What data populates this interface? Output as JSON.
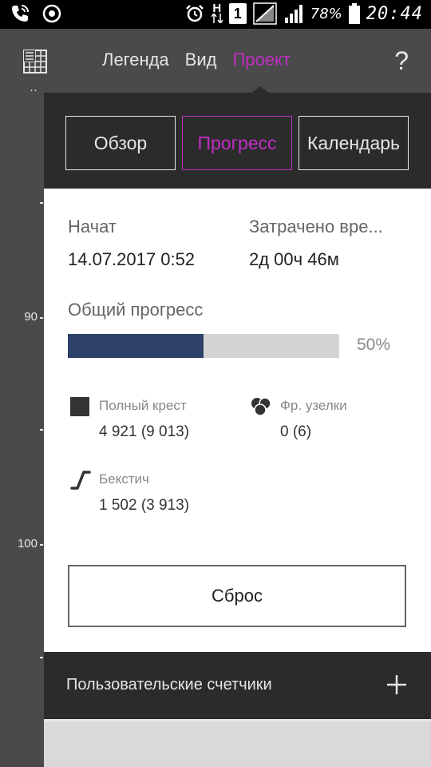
{
  "status_bar": {
    "icons": [
      "phone-wifi-icon",
      "sync-icon",
      "alarm-icon",
      "h-signal-icon",
      "sim1-icon",
      "signal-icon",
      "signal-icon",
      "battery-icon"
    ],
    "network_label": "H",
    "sim_label": "1",
    "battery": "78%",
    "time": "20:44"
  },
  "topbar": {
    "nav": [
      "Легенда",
      "Вид",
      "Проект"
    ],
    "active_nav": "Проект",
    "help": "?",
    "accent_color": "#c02ec4"
  },
  "ruler": {
    "labels": [
      "90",
      "100"
    ]
  },
  "tabs": {
    "items": [
      "Обзор",
      "Прогресс",
      "Календарь"
    ],
    "active": "Прогресс"
  },
  "project": {
    "started_label": "Начат",
    "started_value": "14.07.2017 0:52",
    "spent_label": "Затрачено вре...",
    "spent_value": "2д 00ч 46м",
    "overall_label": "Общий прогресс",
    "progress_percent": 50,
    "progress_text": "50%",
    "progress_color": "#2e4168"
  },
  "stats": [
    {
      "icon": "full-cross-icon",
      "label": "Полный крест",
      "value": "4 921 (9 013)"
    },
    {
      "icon": "french-knot-icon",
      "label": "Фр. узелки",
      "value": "0 (6)"
    },
    {
      "icon": "backstitch-icon",
      "label": "Бекстич",
      "value": "1 502 (3 913)"
    }
  ],
  "reset_label": "Сброс",
  "counters": {
    "label": "Пользовательские счетчики",
    "add_icon": "plus-icon"
  }
}
